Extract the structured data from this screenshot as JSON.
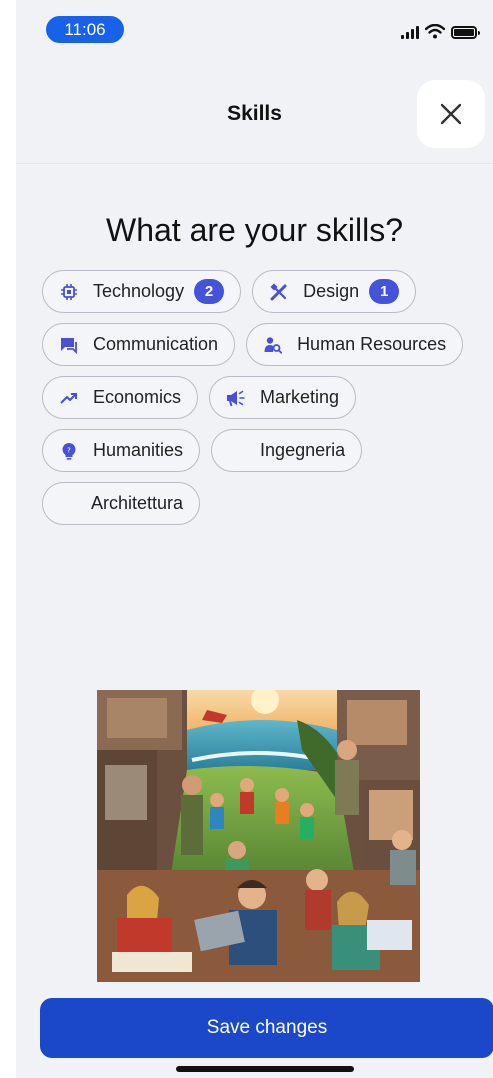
{
  "status_bar": {
    "time": "11:06"
  },
  "header": {
    "title": "Skills"
  },
  "heading": "What are your skills?",
  "chips": [
    {
      "label": "Technology",
      "icon": "chip-icon",
      "badge": "2"
    },
    {
      "label": "Design",
      "icon": "design-tools-icon",
      "badge": "1"
    },
    {
      "label": "Communication",
      "icon": "chat-icon"
    },
    {
      "label": "Human Resources",
      "icon": "person-search-icon"
    },
    {
      "label": "Economics",
      "icon": "trend-up-icon"
    },
    {
      "label": "Marketing",
      "icon": "megaphone-icon"
    },
    {
      "label": "Humanities",
      "icon": "lightbulb-icon"
    },
    {
      "label": "Ingegneria"
    },
    {
      "label": "Architettura"
    }
  ],
  "save_button": "Save changes",
  "colors": {
    "accent": "#4353db",
    "primary_button": "#1a48c9",
    "time_pill": "#1762e8",
    "icon": "#4a4fd8"
  }
}
